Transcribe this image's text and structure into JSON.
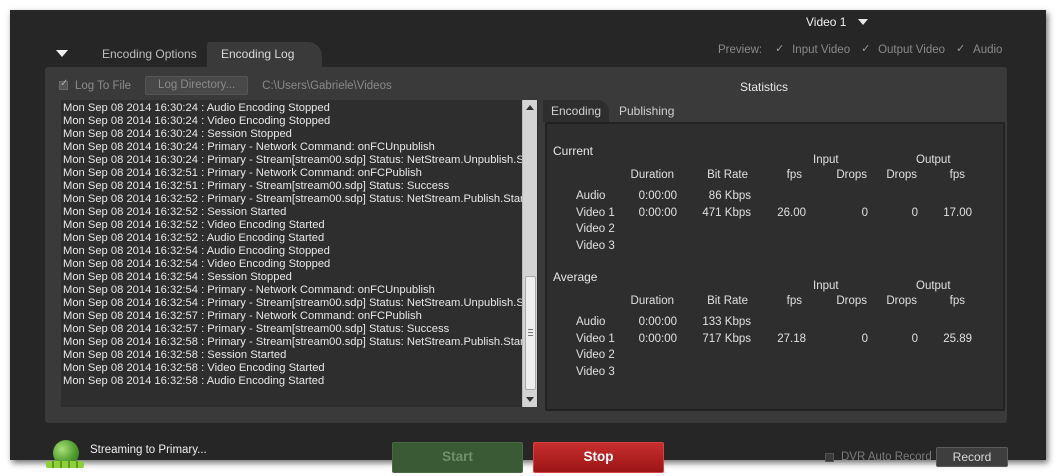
{
  "header": {
    "video_select": "Video 1"
  },
  "tabs": [
    {
      "label": "Encoding Options"
    },
    {
      "label": "Encoding Log"
    }
  ],
  "preview": {
    "label": "Preview:",
    "items": [
      {
        "label": "Input Video",
        "checked": true
      },
      {
        "label": "Output Video",
        "checked": true
      },
      {
        "label": "Audio",
        "checked": true
      }
    ]
  },
  "log_toolbar": {
    "log_to_file": "Log To File",
    "log_directory_button": "Log Directory...",
    "path": "C:\\Users\\Gabriele\\Videos"
  },
  "log_lines": [
    "Mon Sep 08 2014 16:30:24 : Audio Encoding Stopped",
    "Mon Sep 08 2014 16:30:24 : Video Encoding Stopped",
    "Mon Sep 08 2014 16:30:24 : Session Stopped",
    "Mon Sep 08 2014 16:30:24 : Primary - Network Command: onFCUnpublish",
    "Mon Sep 08 2014 16:30:24 : Primary - Stream[stream00.sdp] Status: NetStream.Unpublish.Suc",
    "Mon Sep 08 2014 16:32:51 : Primary - Network Command: onFCPublish",
    "Mon Sep 08 2014 16:32:51 : Primary - Stream[stream00.sdp] Status: Success",
    "Mon Sep 08 2014 16:32:52 : Primary - Stream[stream00.sdp] Status: NetStream.Publish.Start",
    "Mon Sep 08 2014 16:32:52 : Session Started",
    "Mon Sep 08 2014 16:32:52 : Video Encoding Started",
    "Mon Sep 08 2014 16:32:52 : Audio Encoding Started",
    "Mon Sep 08 2014 16:32:54 : Audio Encoding Stopped",
    "Mon Sep 08 2014 16:32:54 : Video Encoding Stopped",
    "Mon Sep 08 2014 16:32:54 : Session Stopped",
    "Mon Sep 08 2014 16:32:54 : Primary - Network Command: onFCUnpublish",
    "Mon Sep 08 2014 16:32:54 : Primary - Stream[stream00.sdp] Status: NetStream.Unpublish.Suc",
    "Mon Sep 08 2014 16:32:57 : Primary - Network Command: onFCPublish",
    "Mon Sep 08 2014 16:32:57 : Primary - Stream[stream00.sdp] Status: Success",
    "Mon Sep 08 2014 16:32:58 : Primary - Stream[stream00.sdp] Status: NetStream.Publish.Start",
    "Mon Sep 08 2014 16:32:58 : Session Started",
    "Mon Sep 08 2014 16:32:58 : Video Encoding Started",
    "Mon Sep 08 2014 16:32:58 : Audio Encoding Started"
  ],
  "statistics": {
    "title": "Statistics",
    "tabs": [
      "Encoding",
      "Publishing"
    ],
    "group_input": "Input",
    "group_output": "Output",
    "columns": [
      "Duration",
      "Bit Rate",
      "fps",
      "Drops",
      "Drops",
      "fps"
    ],
    "current": {
      "title": "Current",
      "rows": [
        {
          "label": "Audio",
          "duration": "0:00:00",
          "bitrate": "86 Kbps",
          "in_fps": "",
          "in_drops": "",
          "out_drops": "",
          "out_fps": ""
        },
        {
          "label": "Video 1",
          "duration": "0:00:00",
          "bitrate": "471 Kbps",
          "in_fps": "26.00",
          "in_drops": "0",
          "out_drops": "0",
          "out_fps": "17.00"
        },
        {
          "label": "Video 2",
          "duration": "",
          "bitrate": "",
          "in_fps": "",
          "in_drops": "",
          "out_drops": "",
          "out_fps": ""
        },
        {
          "label": "Video 3",
          "duration": "",
          "bitrate": "",
          "in_fps": "",
          "in_drops": "",
          "out_drops": "",
          "out_fps": ""
        }
      ]
    },
    "average": {
      "title": "Average",
      "rows": [
        {
          "label": "Audio",
          "duration": "0:00:00",
          "bitrate": "133 Kbps",
          "in_fps": "",
          "in_drops": "",
          "out_drops": "",
          "out_fps": ""
        },
        {
          "label": "Video 1",
          "duration": "0:00:00",
          "bitrate": "717 Kbps",
          "in_fps": "27.18",
          "in_drops": "0",
          "out_drops": "0",
          "out_fps": "25.89"
        },
        {
          "label": "Video 2",
          "duration": "",
          "bitrate": "",
          "in_fps": "",
          "in_drops": "",
          "out_drops": "",
          "out_fps": ""
        },
        {
          "label": "Video 3",
          "duration": "",
          "bitrate": "",
          "in_fps": "",
          "in_drops": "",
          "out_drops": "",
          "out_fps": ""
        }
      ]
    }
  },
  "footer": {
    "status": "Streaming to Primary...",
    "start_button": "Start",
    "stop_button": "Stop",
    "dvr_auto_record": "DVR Auto Record",
    "record_button": "Record"
  },
  "colors": {
    "background": "#262626",
    "panel": "#3a3a3a",
    "start_green": "#3a5a35",
    "stop_red": "#c82e2e"
  }
}
